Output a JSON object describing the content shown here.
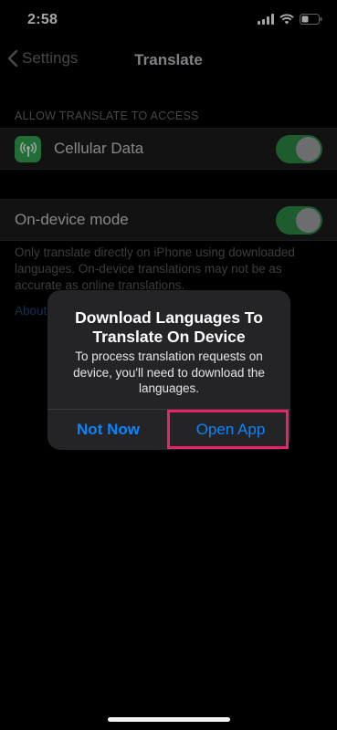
{
  "status_bar": {
    "time": "2:58"
  },
  "nav": {
    "back_label": "Settings",
    "title": "Translate"
  },
  "access_section": {
    "header": "ALLOW TRANSLATE TO ACCESS",
    "cellular": {
      "label": "Cellular Data",
      "icon": "antenna-icon",
      "enabled": true
    }
  },
  "on_device": {
    "label": "On-device mode",
    "enabled": true,
    "footer": "Only translate directly on iPhone using downloaded languages. On-device translations may not be as accurate as online translations.",
    "link": "About"
  },
  "alert": {
    "title": "Download Languages To Translate On Device",
    "message": "To process translation requests on device, you'll need to download the languages.",
    "secondary_button": "Not Now",
    "primary_button": "Open App"
  },
  "colors": {
    "accent": "#0a84ff",
    "toggle_on": "#2d8e45",
    "highlight": "#e6246b"
  }
}
